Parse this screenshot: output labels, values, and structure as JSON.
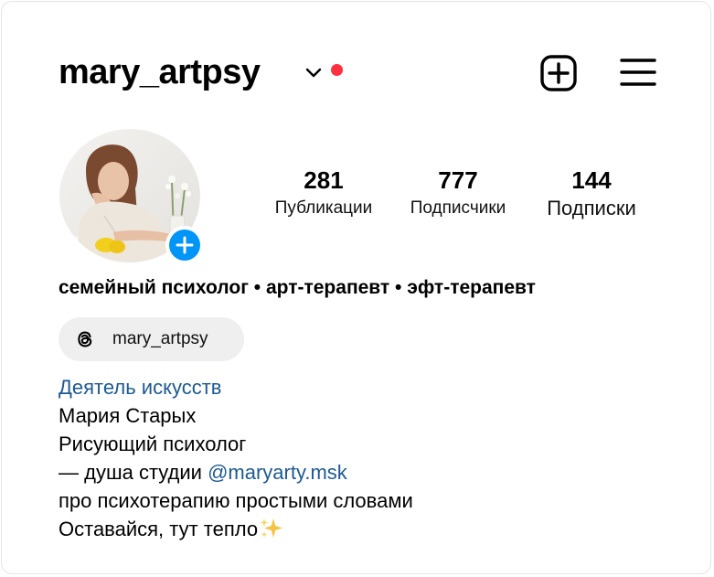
{
  "header": {
    "username": "mary_artpsy",
    "chevron_icon": "chevron-down-icon",
    "notification_dot_color": "#ff3040",
    "create_icon": "plus-square-icon",
    "menu_icon": "hamburger-menu-icon"
  },
  "profile": {
    "avatar_description": "profile photo",
    "add_story_icon": "plus-circle-icon",
    "add_story_color": "#0095f6"
  },
  "stats": [
    {
      "value": "281",
      "label": "Публикации"
    },
    {
      "value": "777",
      "label": "Подписчики"
    },
    {
      "value": "144",
      "label": "Подписки"
    }
  ],
  "headline": "семейный психолог • арт-терапевт • эфт-терапевт",
  "threads": {
    "icon": "threads-icon",
    "label": "mary_artpsy"
  },
  "bio": {
    "category": "Деятель искусств",
    "line1": "Мария Старых",
    "line2": "Рисующий психолог",
    "line3_prefix": "— душа студии ",
    "line3_mention": "@maryarty.msk",
    "line4": "про психотерапию простыми словами",
    "line5": "Оставайся, тут тепло",
    "line5_emoji": "sparkles-icon"
  },
  "colors": {
    "link": "#1d5a93",
    "text": "#000000",
    "chip_background": "#efefef"
  }
}
